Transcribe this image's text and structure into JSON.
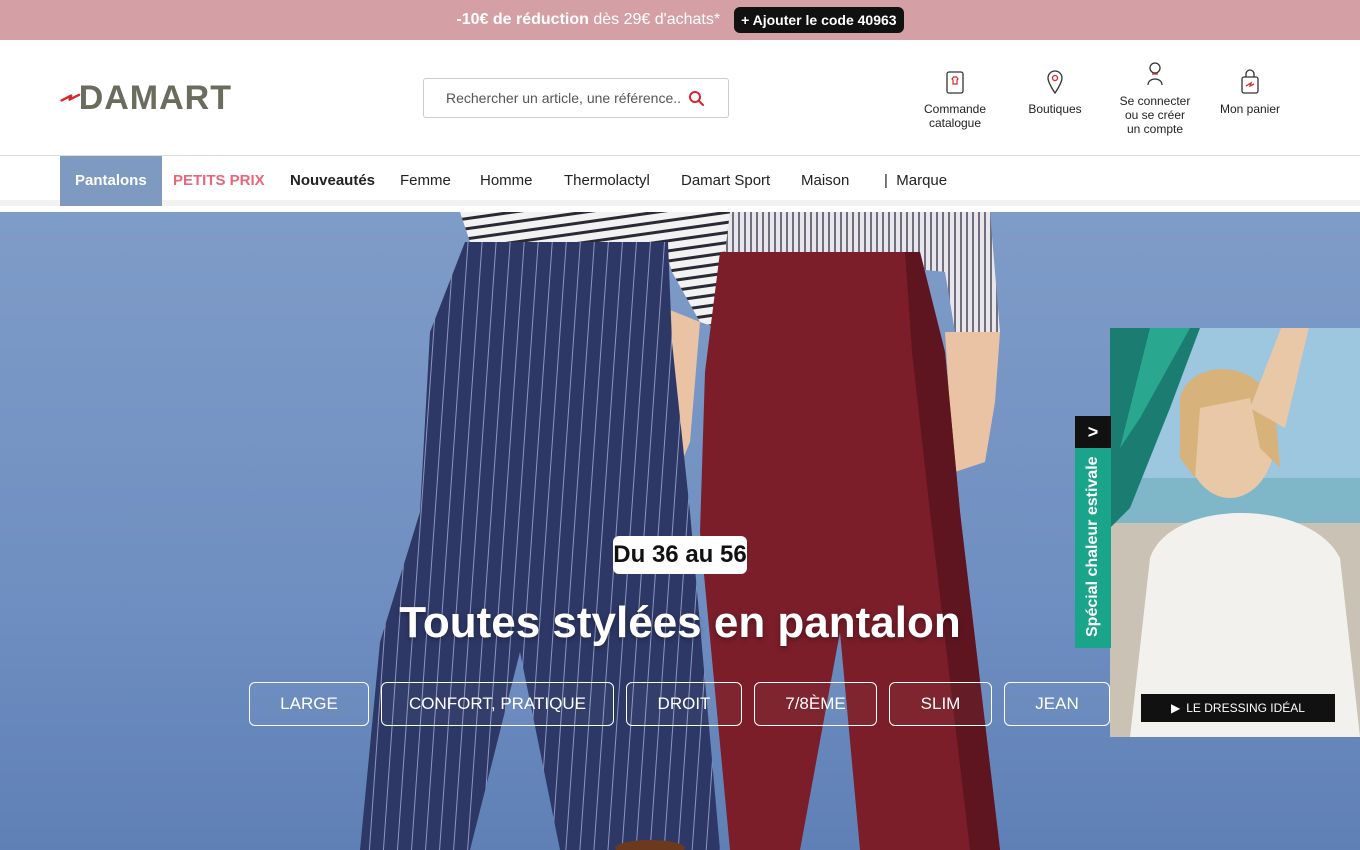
{
  "promo": {
    "bold": "-10€ de réduction",
    "text": "dès 29€ d'achats*",
    "button": "+ Ajouter le code 40963"
  },
  "header": {
    "logo": "DAMART",
    "search_placeholder": "Rechercher un article, une référence...",
    "items": [
      {
        "label": "Commande catalogue"
      },
      {
        "label": "Boutiques"
      },
      {
        "label": "Se connecter ou se créer un compte"
      },
      {
        "label": "Mon panier"
      }
    ]
  },
  "nav": {
    "items": [
      {
        "label": "Pantalons"
      },
      {
        "label": "PETITS PRIX"
      },
      {
        "label": "Nouveautés"
      },
      {
        "label": "Femme"
      },
      {
        "label": "Homme"
      },
      {
        "label": "Thermolactyl"
      },
      {
        "label": "Damart Sport"
      },
      {
        "label": "Maison"
      },
      {
        "label": "|  Marque"
      }
    ]
  },
  "hero": {
    "tag": "Du 36 au 56",
    "title": "Toutes stylées en pantalon",
    "chips": [
      "LARGE",
      "CONFORT, PRATIQUE",
      "DROIT",
      "7/8ÈME",
      "SLIM",
      "JEAN"
    ]
  },
  "side_promo": {
    "arrow": ">",
    "tab_text": "Spécial chaleur estivale",
    "button": "LE DRESSING IDÉAL"
  },
  "colors": {
    "promo_bar": "#d4a0a6",
    "nav_active": "#7f9ac0",
    "petits_prix": "#e8667b",
    "side_tab": "#1aa58b",
    "hero_bg": "#7396c6"
  }
}
